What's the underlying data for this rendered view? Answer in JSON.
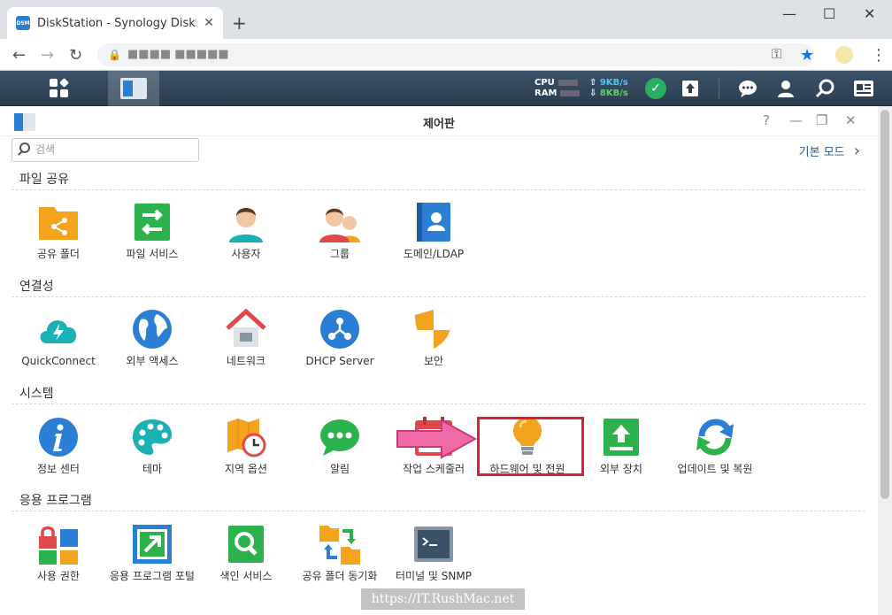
{
  "browser": {
    "tab_title": "DiskStation - Synology DiskStation",
    "tab_close": "✕",
    "new_tab": "+",
    "minimize": "—",
    "maximize": "☐",
    "close": "✕",
    "url_masked": "■■■■ ■■■■■",
    "back": "←",
    "forward": "→",
    "reload": "↻",
    "star": "★",
    "key": "⚿",
    "menu": "⋮"
  },
  "taskbar": {
    "cpu_label": "CPU",
    "ram_label": "RAM",
    "upload_speed": "9KB/s",
    "download_speed": "8KB/s"
  },
  "window": {
    "title": "제어판",
    "help": "?",
    "minimize": "—",
    "restore": "❐",
    "close": "✕",
    "search_placeholder": "검색",
    "basic_mode": "기본 모드",
    "basic_mode_chevron": "›"
  },
  "sections": {
    "file_sharing": {
      "title": "파일 공유",
      "items": [
        "공유 폴더",
        "파일 서비스",
        "사용자",
        "그룹",
        "도메인/LDAP"
      ]
    },
    "connectivity": {
      "title": "연결성",
      "items": [
        "QuickConnect",
        "외부 액세스",
        "네트워크",
        "DHCP Server",
        "보안"
      ]
    },
    "system": {
      "title": "시스템",
      "items": [
        "정보 센터",
        "테마",
        "지역 옵션",
        "알림",
        "작업 스케줄러",
        "하드웨어 및 전원",
        "외부 장치",
        "업데이트 및 복원"
      ]
    },
    "applications": {
      "title": "응용 프로그램",
      "items": [
        "사용 권한",
        "응용 프로그램 포털",
        "색인 서비스",
        "공유 폴더 동기화",
        "터미널 및 SNMP"
      ]
    }
  },
  "watermark": "https://IT.RushMac.net",
  "colors": {
    "highlight": "#e02030",
    "arrow": "#f06aa8",
    "taskbar": "#2c3e50"
  }
}
